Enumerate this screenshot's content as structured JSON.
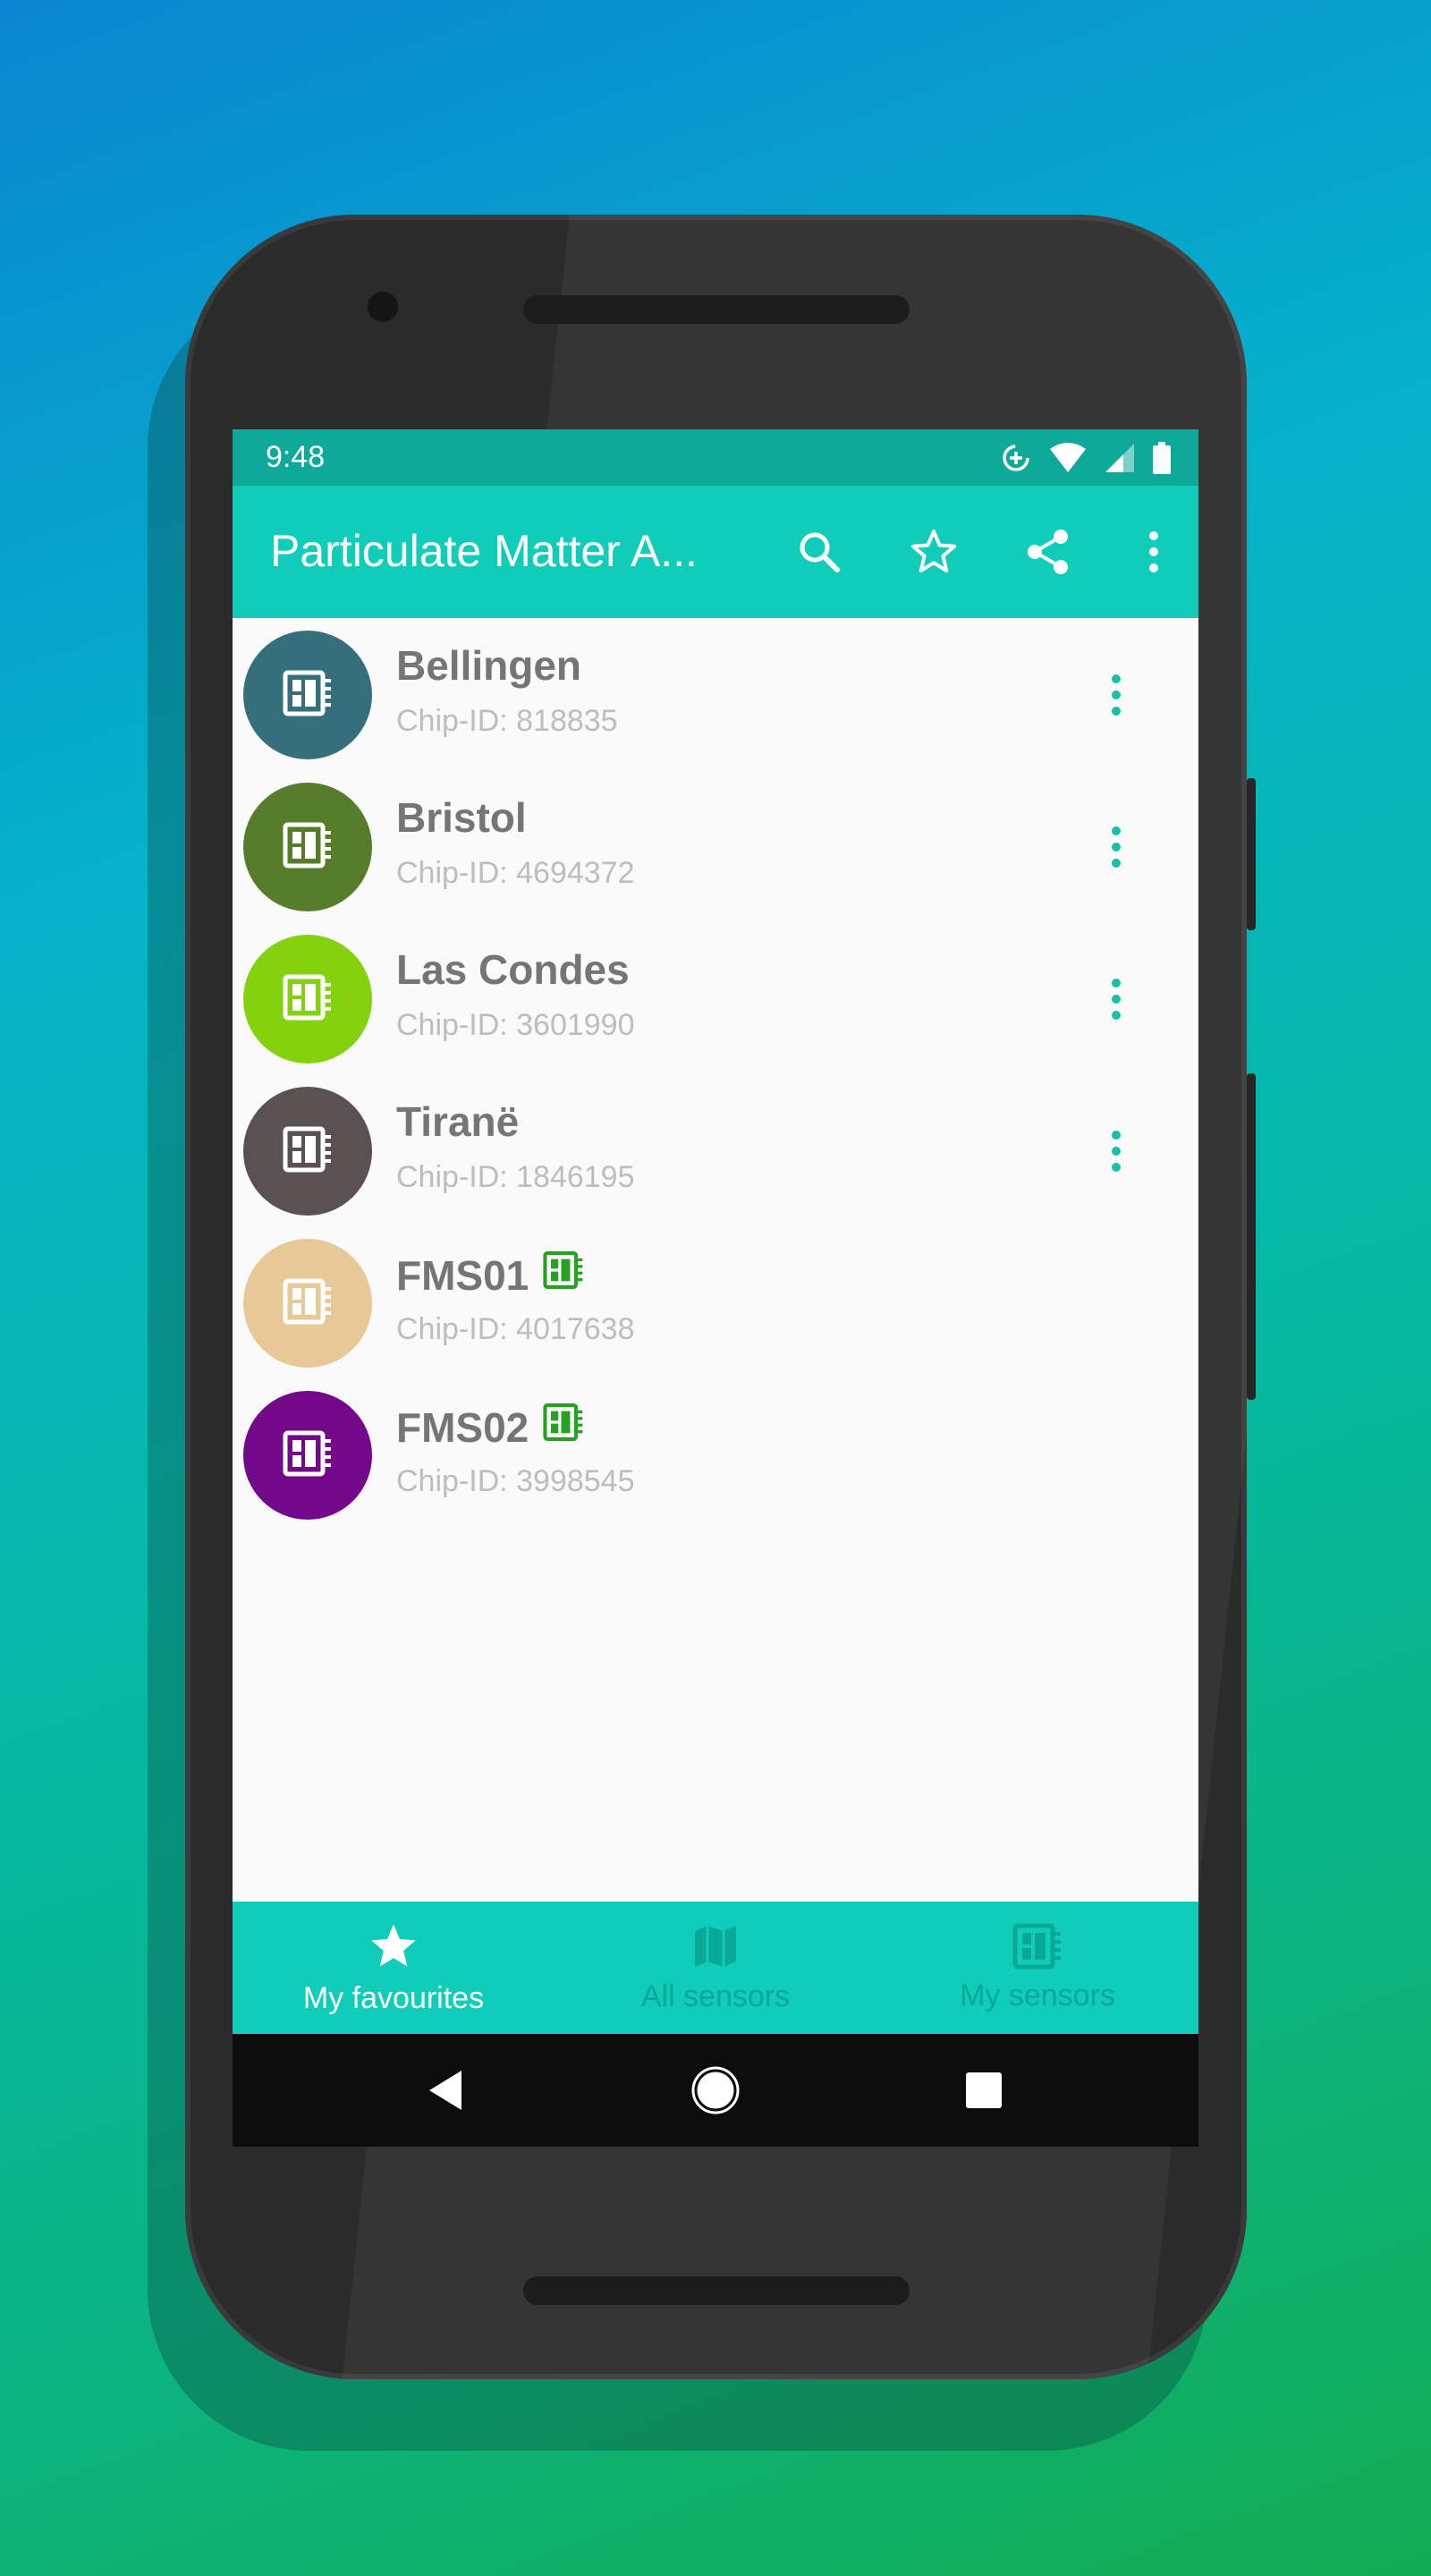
{
  "status_bar": {
    "time": "9:48",
    "icons": [
      "data-saver-icon",
      "wifi-icon",
      "signal-icon",
      "battery-icon"
    ]
  },
  "app_bar": {
    "title": "Particulate Matter A...",
    "actions": [
      "search-icon",
      "star-outline-icon",
      "share-icon",
      "more-vert-icon"
    ]
  },
  "sensors": [
    {
      "name": "Bellingen",
      "chip": "Chip-ID: 818835",
      "color": "#366f7c",
      "has_menu": true,
      "own_badge": false
    },
    {
      "name": "Bristol",
      "chip": "Chip-ID: 4694372",
      "color": "#557d2a",
      "has_menu": true,
      "own_badge": false
    },
    {
      "name": "Las Condes",
      "chip": "Chip-ID: 3601990",
      "color": "#84d10d",
      "has_menu": true,
      "own_badge": false
    },
    {
      "name": "Tiranë",
      "chip": "Chip-ID: 1846195",
      "color": "#5a5252",
      "has_menu": true,
      "own_badge": false
    },
    {
      "name": "FMS01",
      "chip": "Chip-ID: 4017638",
      "color": "#e6c997",
      "has_menu": false,
      "own_badge": true
    },
    {
      "name": "FMS02",
      "chip": "Chip-ID: 3998545",
      "color": "#73098a",
      "has_menu": false,
      "own_badge": true
    }
  ],
  "bottom_nav": {
    "tabs": [
      {
        "label": "My favourites",
        "icon": "star-icon",
        "active": true
      },
      {
        "label": "All sensors",
        "icon": "map-icon",
        "active": false
      },
      {
        "label": "My sensors",
        "icon": "sensor-icon",
        "active": false
      }
    ]
  },
  "colors": {
    "accent": "#0fcdb9",
    "status_bar": "#0fa99a",
    "menu_dots": "#16bfae",
    "own_badge": "#27a023"
  }
}
